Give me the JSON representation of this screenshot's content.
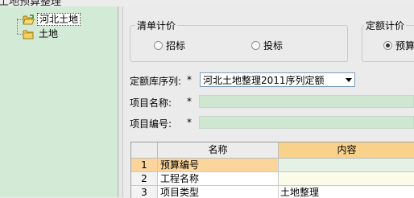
{
  "window": {
    "title_fragment": "土地预算整理"
  },
  "tree": {
    "items": [
      {
        "label": "河北土地",
        "icon": "open-folder-icon",
        "selected": true
      },
      {
        "label": "土地",
        "icon": "folder-icon",
        "selected": false
      }
    ]
  },
  "pricing_group": {
    "title": "清单计价",
    "options": [
      {
        "label": "招标",
        "checked": false
      },
      {
        "label": "投标",
        "checked": false
      }
    ]
  },
  "quota_group": {
    "title": "定额计价",
    "options": [
      {
        "label": "预算",
        "checked": true
      }
    ]
  },
  "form": {
    "library_label": "定额库序列:",
    "library_value": "河北土地整理2011序列定额",
    "name_label": "项目名称:",
    "name_value": "",
    "code_label": "项目编号:",
    "code_value": "",
    "required_mark": "*"
  },
  "grid": {
    "headers": {
      "rownum": "",
      "name": "名称",
      "content": "内容"
    },
    "rows": [
      {
        "num": "1",
        "name": "预算编号",
        "value": ""
      },
      {
        "num": "2",
        "name": "工程名称",
        "value": ""
      },
      {
        "num": "3",
        "name": "项目类型",
        "value": "土地整理"
      }
    ]
  },
  "colors": {
    "tree_bg": "#d3ead6",
    "input_bg": "#cfe6d1",
    "header_accent": "#f8d18a",
    "selected_row": "#fbd59b"
  }
}
